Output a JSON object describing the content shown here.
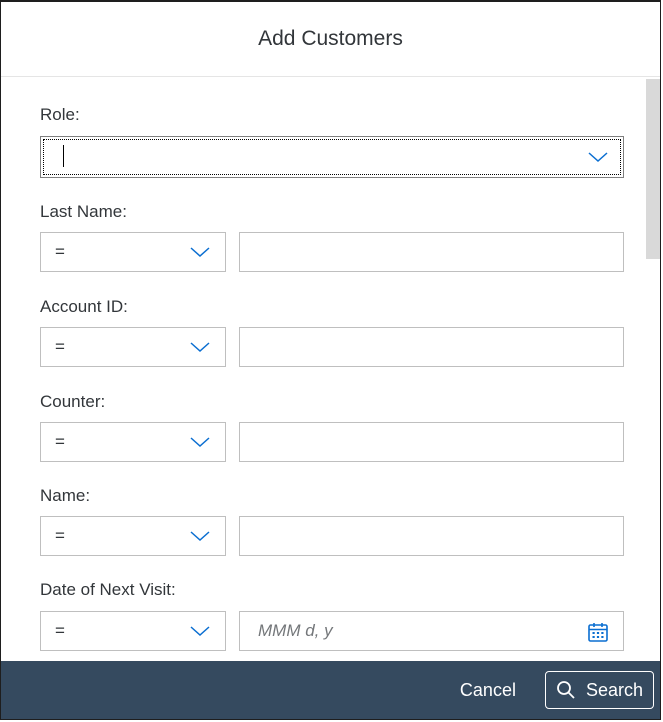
{
  "dialog": {
    "title": "Add Customers"
  },
  "fields": {
    "role": {
      "label": "Role:",
      "value": ""
    },
    "last_name": {
      "label": "Last Name:",
      "operator": "=",
      "value": ""
    },
    "account_id": {
      "label": "Account ID:",
      "operator": "=",
      "value": ""
    },
    "counter": {
      "label": "Counter:",
      "operator": "=",
      "value": ""
    },
    "name": {
      "label": "Name:",
      "operator": "=",
      "value": ""
    },
    "date_of_next_visit": {
      "label": "Date of Next Visit:",
      "operator": "=",
      "placeholder": "MMM d, y"
    }
  },
  "footer": {
    "cancel_label": "Cancel",
    "search_label": "Search"
  },
  "icons": {
    "dropdown": "chevron-down-icon",
    "calendar": "calendar-icon",
    "search": "search-icon"
  },
  "colors": {
    "footer_bg": "#354a5f",
    "accent": "#0a6ed1"
  }
}
